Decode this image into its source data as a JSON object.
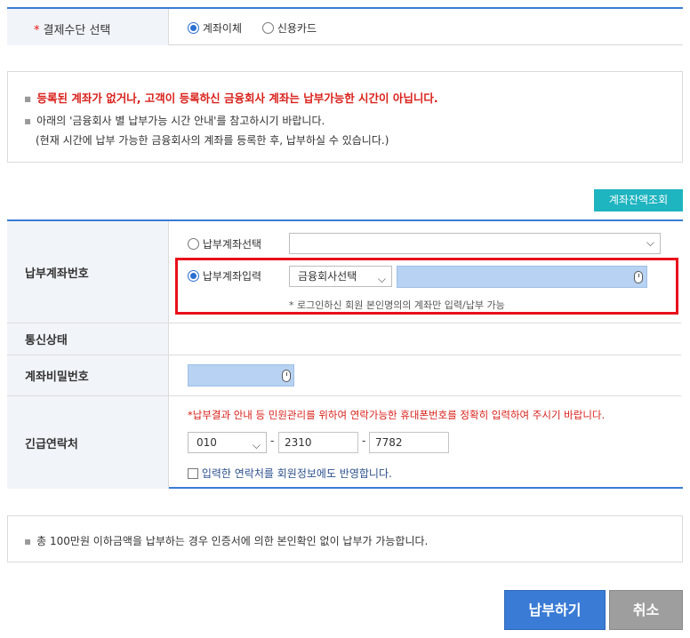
{
  "payment_method": {
    "label": "결제수단 선택",
    "required_mark": "*",
    "options": [
      {
        "label": "계좌이체",
        "selected": true
      },
      {
        "label": "신용카드",
        "selected": false
      }
    ]
  },
  "notice_top": {
    "line1": "등록된 계좌가 없거나, 고객이 등록하신 금융회사 계좌는 납부가능한 시간이 아닙니다.",
    "line2": "아래의 '금융회사 별 납부가능 시간 안내'를 참고하시기 바랍니다.",
    "line3": "(현재 시간에 납부 가능한 금융회사의 계좌를 등록한 후, 납부하실 수 있습니다.)"
  },
  "balance_button": "계좌잔액조회",
  "account": {
    "label": "납부계좌번호",
    "select_option": {
      "label": "납부계좌선택",
      "selected": false,
      "value": ""
    },
    "input_option": {
      "label": "납부계좌입력",
      "selected": true
    },
    "bank_select": "금융회사선택",
    "note": "* 로그인하신 회원 본인명의의 계좌만 입력/납부 가능"
  },
  "comm_status": {
    "label": "통신상태"
  },
  "password": {
    "label": "계좌비밀번호"
  },
  "emergency": {
    "label": "긴급연락처",
    "warning": "*납부결과 안내 등 민원관리를 위하여 연락가능한 휴대폰번호를 정확히 입력하여 주시기 바랍니다.",
    "phone1": "010",
    "phone2": "2310",
    "phone3": "7782",
    "dash": "-",
    "checkbox_label": "입력한 연락처를 회원정보에도 반영합니다."
  },
  "notice_bottom": "총 100만원 이하금액을 납부하는 경우 인증서에 의한 본인확인 없이 납부가 가능합니다.",
  "buttons": {
    "submit": "납부하기",
    "cancel": "취소"
  },
  "colors": {
    "accent": "#3a7bd5",
    "teal": "#1eb4c0",
    "highlight": "#e8101a",
    "warning": "#d9211b"
  }
}
